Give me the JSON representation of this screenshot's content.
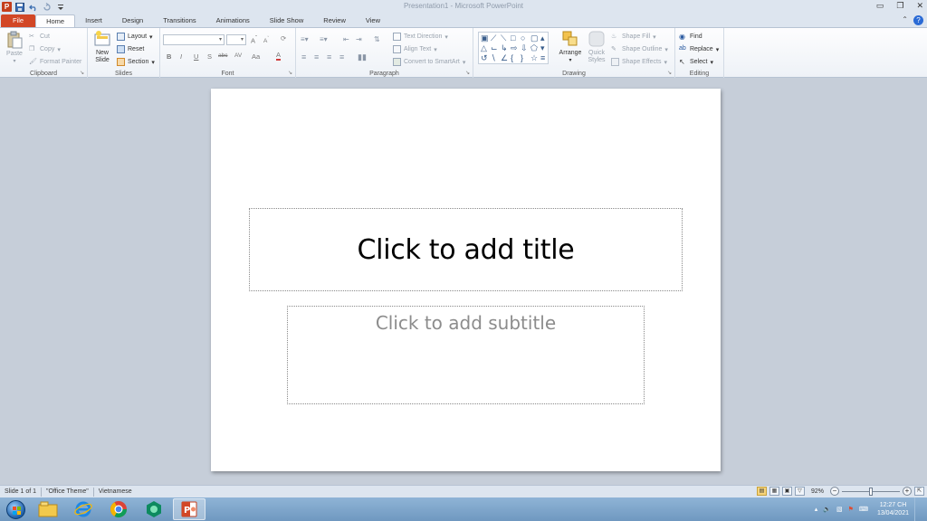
{
  "window": {
    "title": "Presentation1 - Microsoft PowerPoint",
    "app_icon_letter": "P",
    "quick_access": [
      "save-icon",
      "undo-icon",
      "redo-icon",
      "customize-icon"
    ]
  },
  "tabs": [
    "File",
    "Home",
    "Insert",
    "Design",
    "Transitions",
    "Animations",
    "Slide Show",
    "Review",
    "View"
  ],
  "active_tab": "Home",
  "ribbon": {
    "clipboard": {
      "label": "Clipboard",
      "paste": "Paste",
      "cut": "Cut",
      "copy": "Copy",
      "format_painter": "Format Painter"
    },
    "slides": {
      "label": "Slides",
      "new_slide_line1": "New",
      "new_slide_line2": "Slide",
      "layout": "Layout",
      "reset": "Reset",
      "section": "Section"
    },
    "font": {
      "label": "Font",
      "font_name": "",
      "font_size": "",
      "bold": "B",
      "italic": "I",
      "underline": "U",
      "shadow": "S",
      "strike": "abc",
      "spacing": "AV",
      "case": "Aa",
      "color": "A",
      "grow": "A",
      "shrink": "A"
    },
    "paragraph": {
      "label": "Paragraph",
      "text_direction": "Text Direction",
      "align_text": "Align Text",
      "convert_smartart": "Convert to SmartArt"
    },
    "drawing": {
      "label": "Drawing",
      "arrange": "Arrange",
      "quick_styles_line1": "Quick",
      "quick_styles_line2": "Styles",
      "shape_fill": "Shape Fill",
      "shape_outline": "Shape Outline",
      "shape_effects": "Shape Effects"
    },
    "editing": {
      "label": "Editing",
      "find": "Find",
      "replace": "Replace",
      "select": "Select"
    }
  },
  "slide": {
    "title_placeholder": "Click to add title",
    "subtitle_placeholder": "Click to add subtitle"
  },
  "status": {
    "slide_info": "Slide 1 of 1",
    "theme": "\"Office Theme\"",
    "language": "Vietnamese",
    "zoom": "92%"
  },
  "taskbar": {
    "time": "12:27 CH",
    "date": "13/04/2021"
  },
  "colors": {
    "file_tab": "#d24726",
    "accent": "#2a5aa0"
  }
}
